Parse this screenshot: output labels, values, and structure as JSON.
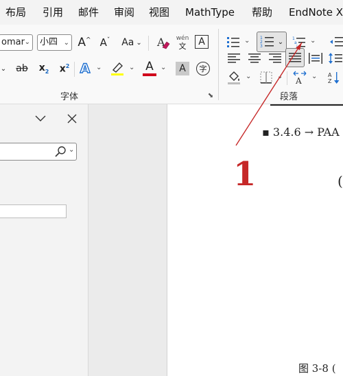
{
  "menu": {
    "tabs": [
      "布局",
      "引用",
      "邮件",
      "审阅",
      "视图",
      "MathType",
      "帮助",
      "EndNote X"
    ]
  },
  "ribbon": {
    "font_name": "omar",
    "font_size": "小四",
    "font_group_label": "字体",
    "paragraph_group_label": "段落",
    "grow_font_glyph": "A",
    "shrink_font_glyph": "A",
    "change_case_label": "Aa",
    "phonetic_top": "wén",
    "phonetic_bottom": "文",
    "border_char": "A",
    "strikethrough_label": "ab",
    "subscript_label": "x",
    "subscript_sub": "2",
    "superscript_label": "x",
    "superscript_sup": "2",
    "text_effect_glyph": "A",
    "font_color_glyph": "A",
    "shading_char": "A",
    "enclose_char": "字",
    "font_color_hex": "#d0021b",
    "highlight_color_hex": "#ffff00"
  },
  "navpane": {
    "search_placeholder": ""
  },
  "document": {
    "heading_text": "▪ 3.4.6 → PAA",
    "paren_text": "(",
    "caption_text": "图 3-8  (",
    "annotation_number": "1",
    "annotation_color_hex": "#d0021b"
  }
}
